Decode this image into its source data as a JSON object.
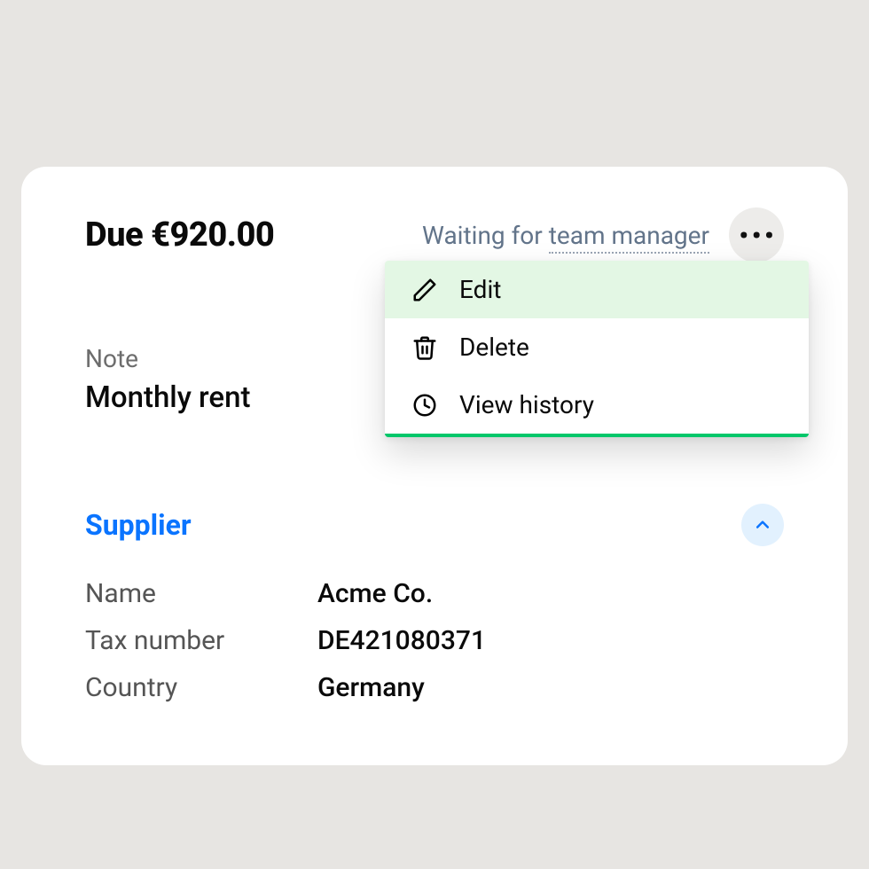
{
  "header": {
    "due_label": "Due €920.00",
    "status_prefix": "Waiting for ",
    "status_role": "team manager"
  },
  "note": {
    "label": "Note",
    "value": "Monthly rent"
  },
  "sections": {
    "supplier": {
      "title": "Supplier",
      "fields": {
        "name_label": "Name",
        "name_value": "Acme Co.",
        "tax_label": "Tax number",
        "tax_value": "DE421080371",
        "country_label": "Country",
        "country_value": "Germany"
      }
    }
  },
  "menu": {
    "edit": "Edit",
    "delete": "Delete",
    "history": "View history"
  },
  "colors": {
    "accent_blue": "#0a74ff",
    "accent_green": "#00c76a",
    "menu_highlight": "#e3f7e4"
  }
}
